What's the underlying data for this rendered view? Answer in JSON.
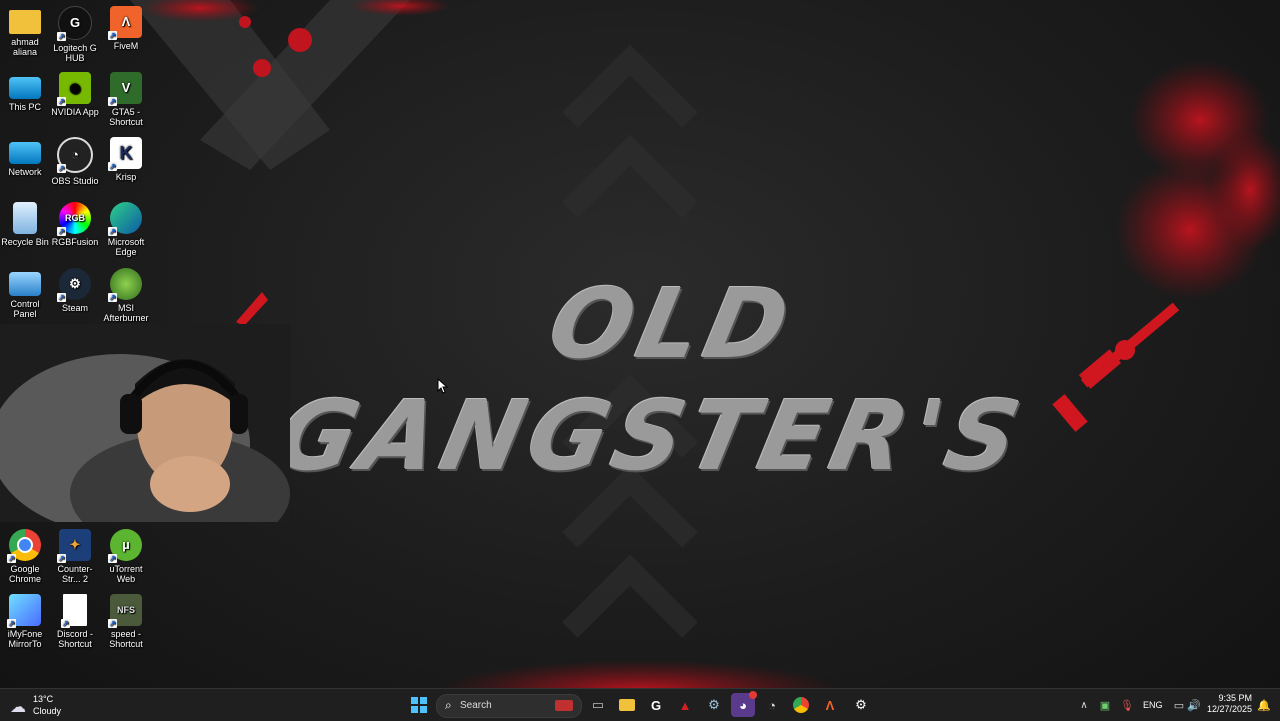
{
  "wallpaper": {
    "banner_text": "OLD GANGSTER'S",
    "accent_color": "#b3121b"
  },
  "desktop": {
    "icons": [
      {
        "label": "ahmad aliana",
        "icon": "folder-icon",
        "shortcut": false
      },
      {
        "label": "Logitech G HUB",
        "icon": "logitech-g-icon",
        "shortcut": true
      },
      {
        "label": "FiveM",
        "icon": "fivem-icon",
        "shortcut": true
      },
      {
        "label": "This PC",
        "icon": "computer-icon",
        "shortcut": false
      },
      {
        "label": "NVIDIA App",
        "icon": "nvidia-icon",
        "shortcut": true
      },
      {
        "label": "GTA5 - Shortcut",
        "icon": "gta5-icon",
        "shortcut": true
      },
      {
        "label": "Network",
        "icon": "network-icon",
        "shortcut": false
      },
      {
        "label": "OBS Studio",
        "icon": "obs-icon",
        "shortcut": true
      },
      {
        "label": "Krisp",
        "icon": "krisp-icon",
        "shortcut": true
      },
      {
        "label": "Recycle Bin",
        "icon": "recycle-bin-icon",
        "shortcut": false
      },
      {
        "label": "RGBFusion",
        "icon": "rgbfusion-icon",
        "shortcut": true
      },
      {
        "label": "Microsoft Edge",
        "icon": "edge-icon",
        "shortcut": true
      },
      {
        "label": "Control Panel",
        "icon": "control-panel-icon",
        "shortcut": false
      },
      {
        "label": "Steam",
        "icon": "steam-icon",
        "shortcut": true
      },
      {
        "label": "MSI Afterburner",
        "icon": "msi-afterburner-icon",
        "shortcut": true
      },
      {
        "label": "Google Chrome",
        "icon": "chrome-icon",
        "shortcut": true
      },
      {
        "label": "Counter-Str... 2",
        "icon": "counter-strike-icon",
        "shortcut": true
      },
      {
        "label": "uTorrent Web",
        "icon": "utorrent-icon",
        "shortcut": true
      },
      {
        "label": "iMyFone MirrorTo",
        "icon": "imyfone-icon",
        "shortcut": true
      },
      {
        "label": "Discord - Shortcut",
        "icon": "file-icon",
        "shortcut": true
      },
      {
        "label": "speed - Shortcut",
        "icon": "nfs-mw-icon",
        "shortcut": true
      }
    ]
  },
  "webcam": {
    "description_icon": "webcam-overlay"
  },
  "taskbar": {
    "weather": {
      "temperature": "13°C",
      "condition": "Cloudy"
    },
    "search_label": "Search",
    "pinned": [
      {
        "name": "task-view",
        "icon": "task-view-icon"
      },
      {
        "name": "file-explorer",
        "icon": "folder-icon"
      },
      {
        "name": "logitech",
        "icon": "logitech-g-icon"
      },
      {
        "name": "app-red",
        "icon": "red-triangle-icon"
      },
      {
        "name": "steam",
        "icon": "steam-icon"
      },
      {
        "name": "discord",
        "icon": "discord-icon"
      },
      {
        "name": "obs",
        "icon": "obs-icon"
      },
      {
        "name": "chrome",
        "icon": "chrome-icon"
      },
      {
        "name": "fivem",
        "icon": "fivem-icon"
      },
      {
        "name": "settings",
        "icon": "gear-icon"
      }
    ],
    "tray": {
      "language": "ENG",
      "time": "9:35 PM",
      "date": "12/27/2025"
    }
  }
}
